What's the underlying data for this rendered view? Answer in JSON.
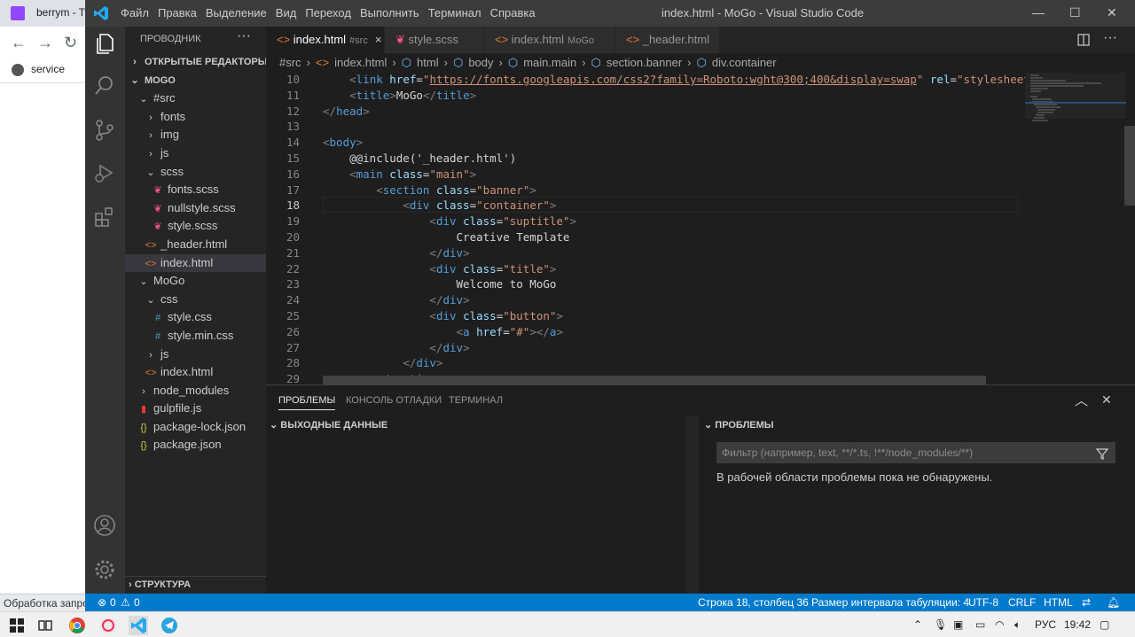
{
  "browser": {
    "tab_title": "berrym - Tw",
    "bookmark": "service",
    "status": "Обработка запро"
  },
  "window": {
    "title": "index.html - MoGo - Visual Studio Code",
    "menu": [
      "Файл",
      "Правка",
      "Выделение",
      "Вид",
      "Переход",
      "Выполнить",
      "Терминал",
      "Справка"
    ]
  },
  "sidebar": {
    "header": "ПРОВОДНИК",
    "open_editors": "ОТКРЫТЫЕ РЕДАКТОРЫ",
    "project": "MOGO",
    "outline": "СТРУКТУРА",
    "items": [
      {
        "label": "#src",
        "type": "folder-open"
      },
      {
        "label": "fonts",
        "type": "folder"
      },
      {
        "label": "img",
        "type": "folder"
      },
      {
        "label": "js",
        "type": "folder"
      },
      {
        "label": "scss",
        "type": "folder-open"
      },
      {
        "label": "fonts.scss",
        "type": "scss"
      },
      {
        "label": "nullstyle.scss",
        "type": "scss"
      },
      {
        "label": "style.scss",
        "type": "scss"
      },
      {
        "label": "_header.html",
        "type": "html"
      },
      {
        "label": "index.html",
        "type": "html"
      },
      {
        "label": "MoGo",
        "type": "folder-open"
      },
      {
        "label": "css",
        "type": "folder-open"
      },
      {
        "label": "style.css",
        "type": "css"
      },
      {
        "label": "style.min.css",
        "type": "css"
      },
      {
        "label": "js",
        "type": "folder"
      },
      {
        "label": "index.html",
        "type": "html"
      },
      {
        "label": "node_modules",
        "type": "folder"
      },
      {
        "label": "gulpfile.js",
        "type": "gulp"
      },
      {
        "label": "package-lock.json",
        "type": "json"
      },
      {
        "label": "package.json",
        "type": "json"
      }
    ]
  },
  "tabs": [
    {
      "label": "index.html",
      "sub": "#src",
      "close": "×"
    },
    {
      "label": "style.scss",
      "sub": ""
    },
    {
      "label": "index.html",
      "sub": "MoGo"
    },
    {
      "label": "_header.html",
      "sub": ""
    }
  ],
  "breadcrumb": [
    "#src",
    "›",
    "index.html",
    "›",
    "html",
    "›",
    "body",
    "›",
    "main.main",
    "›",
    "section.banner",
    "›",
    "div.container"
  ],
  "editor": {
    "current_line": 18,
    "lines": [
      10,
      11,
      12,
      13,
      14,
      15,
      16,
      17,
      18,
      19,
      20,
      21,
      22,
      23,
      24,
      25,
      26,
      27,
      28,
      29
    ]
  },
  "panel": {
    "tabs": [
      "ПРОБЛЕМЫ",
      "КОНСОЛЬ ОТЛАДКИ",
      "ТЕРМИНАЛ"
    ],
    "output_header": "ВЫХОДНЫЕ ДАННЫЕ",
    "problems_header": "ПРОБЛЕМЫ",
    "filter_placeholder": "Фильтр (например, text, **/*.ts, !**/node_modules/**)",
    "no_problems": "В рабочей области проблемы пока не обнаружены."
  },
  "statusbar": {
    "errors": "0",
    "warnings": "0",
    "position": "Строка 18, столбец 36",
    "indent": "Размер интервала табуляции: 4",
    "encoding": "UTF-8",
    "eol": "CRLF",
    "language": "HTML"
  },
  "taskbar": {
    "lang": "РУС",
    "time": "19:42"
  },
  "colors": {
    "accent": "#007acc",
    "scss": "#f55385",
    "html": "#e37933",
    "css": "#519aba",
    "json": "#cbcb41"
  }
}
